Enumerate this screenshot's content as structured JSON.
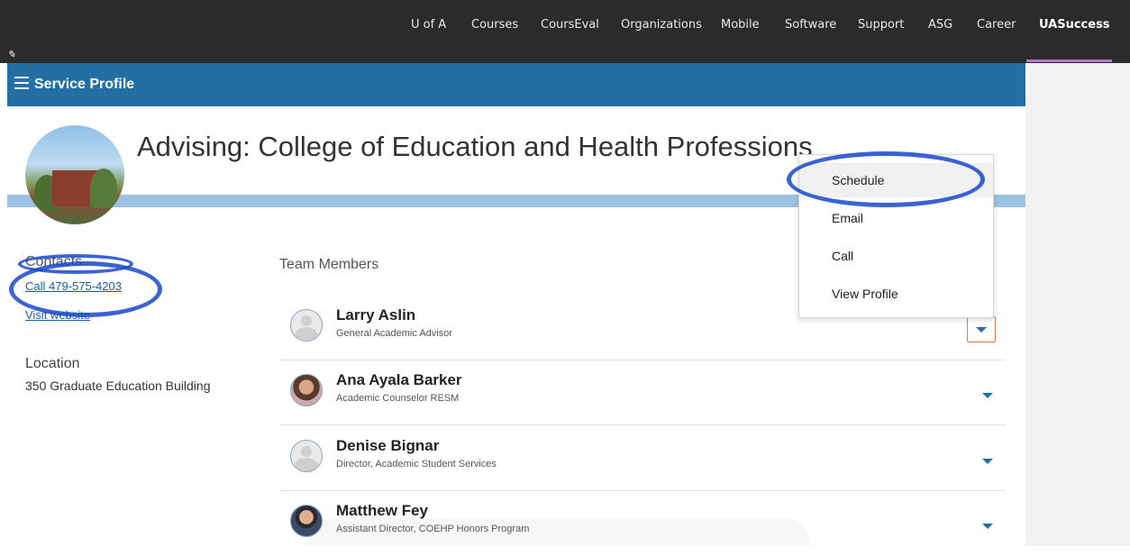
{
  "topnav": {
    "items": [
      "U of A",
      "Courses",
      "CoursEval",
      "Organizations",
      "Mobile",
      "Software",
      "Support",
      "ASG",
      "Career",
      "UASuccess"
    ],
    "active": "UASuccess",
    "pen_glyph": "✎"
  },
  "service_bar": {
    "title": "Service Profile"
  },
  "header": {
    "title": "Advising: College of Education and Health Professions"
  },
  "contacts": {
    "label": "Contacts",
    "call": "Call 479-575-4203",
    "website": "Visit website"
  },
  "location": {
    "label": "Location",
    "value": "350 Graduate Education Building"
  },
  "team": {
    "label": "Team Members",
    "members": [
      {
        "name": "Larry Aslin",
        "role": "General Academic Advisor",
        "avatar": "default-avatar"
      },
      {
        "name": "Ana Ayala Barker",
        "role": "Academic Counselor RESM",
        "avatar": "photo"
      },
      {
        "name": "Denise Bignar",
        "role": "Director, Academic Student Services",
        "avatar": "default-avatar"
      },
      {
        "name": "Matthew Fey",
        "role": "Assistant Director, COEHP Honors Program",
        "avatar": "photo"
      }
    ]
  },
  "dropdown": {
    "items": [
      "Schedule",
      "Email",
      "Call",
      "View Profile"
    ],
    "highlighted": "Schedule"
  },
  "colors": {
    "brand_blue": "#236fa4",
    "scribble": "#1749c9",
    "topbar": "#2b2b2b"
  }
}
